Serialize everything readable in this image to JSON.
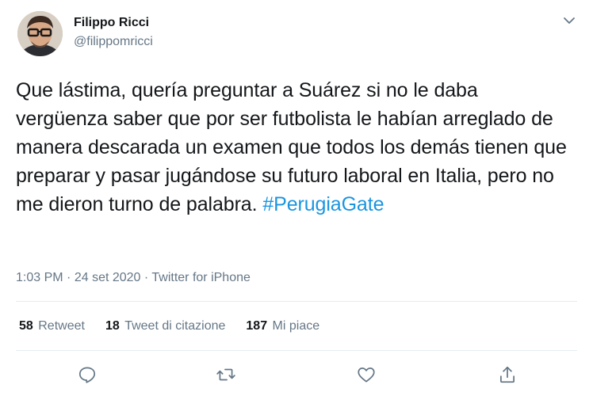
{
  "author": {
    "name": "Filippo Ricci",
    "handle": "@filippomricci"
  },
  "tweet": {
    "text": "Que lástima, quería preguntar a Suárez si no le daba vergüenza saber que por ser futbolista le habían arreglado de manera descarada un examen que todos los demás tienen que preparar y pasar jugándose su futuro laboral en Italia, pero no me dieron turno de palabra.",
    "hashtag": "#PerugiaGate"
  },
  "meta": {
    "time": "1:03 PM",
    "separator1": "·",
    "date": "24 set 2020",
    "separator2": "·",
    "source": "Twitter for iPhone"
  },
  "stats": [
    {
      "count": "58",
      "label": "Retweet"
    },
    {
      "count": "18",
      "label": "Tweet di citazione"
    },
    {
      "count": "187",
      "label": "Mi piace"
    }
  ],
  "actions": [
    "reply-icon",
    "retweet-icon",
    "like-icon",
    "share-icon"
  ],
  "colors": {
    "text": "#14171a",
    "secondary": "#657786",
    "link": "#1b95e0",
    "divider": "#e6ecf0"
  }
}
